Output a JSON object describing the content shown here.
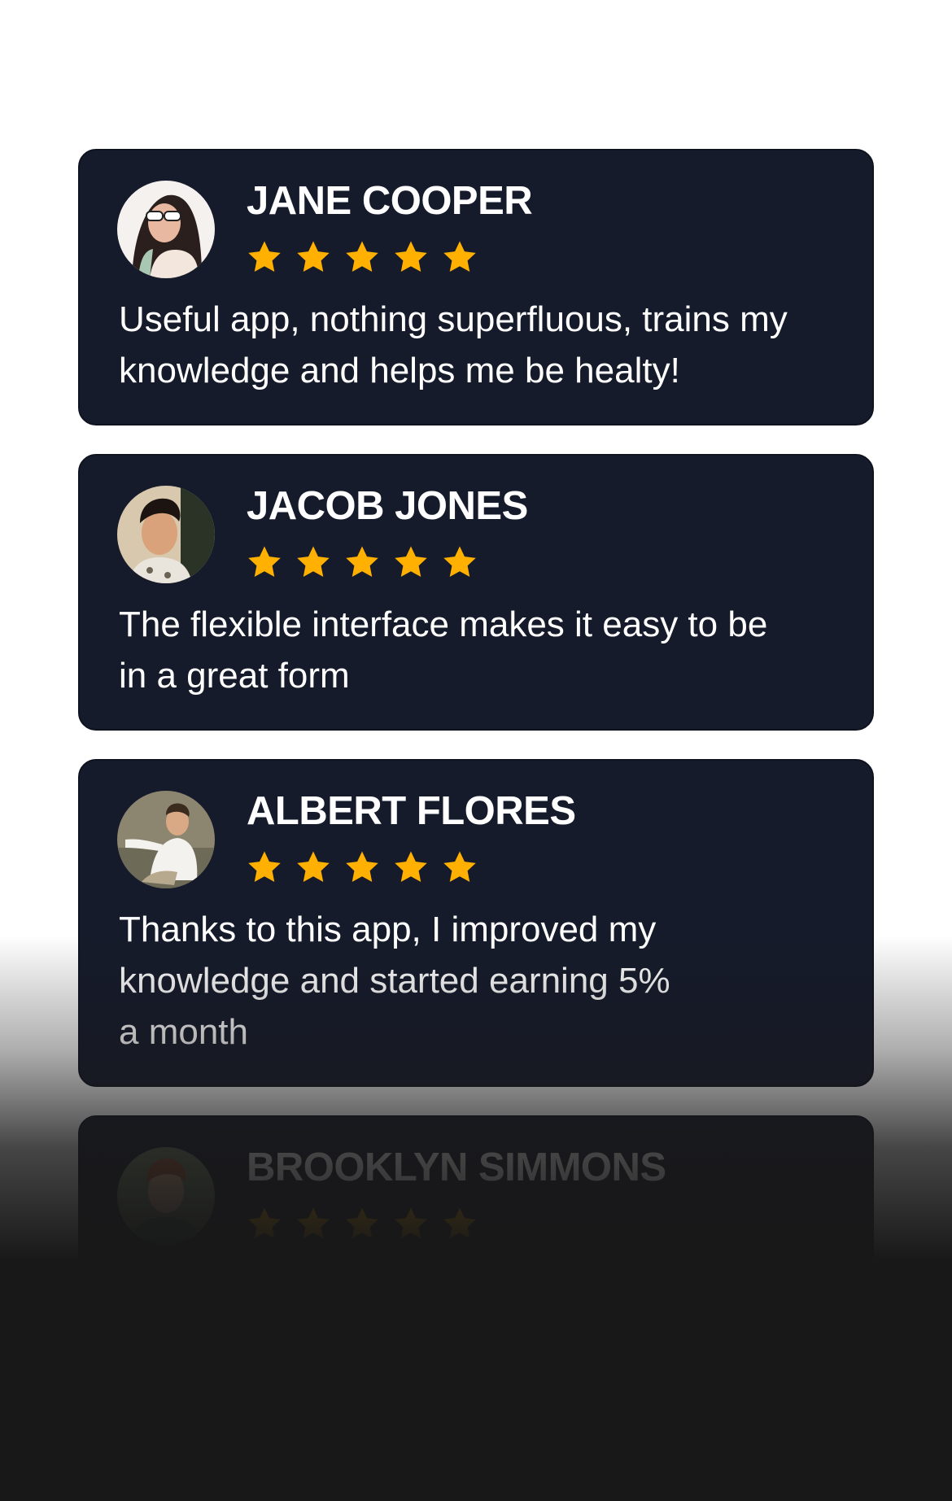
{
  "colors": {
    "card_background": "#161b2b",
    "star": "#ffb000",
    "text": "#ffffff",
    "page_background": "#ffffff",
    "bottom_overlay": "#181818"
  },
  "reviews": [
    {
      "name": "JANE COOPER",
      "rating": 5,
      "text_lines": [
        "Useful app, nothing superfluous, trains my",
        "knowledge and helps me be healty!"
      ],
      "avatar_icon": "avatar-photo-woman-sunglasses"
    },
    {
      "name": "JACOB JONES",
      "rating": 5,
      "text_lines": [
        "The flexible interface makes it easy to be",
        "in a great form"
      ],
      "avatar_icon": "avatar-photo-man-dark-hair"
    },
    {
      "name": "ALBERT FLORES",
      "rating": 5,
      "text_lines": [
        "Thanks to this app, I improved my",
        "knowledge and started earning 5%",
        "a month"
      ],
      "avatar_icon": "avatar-photo-man-white-shirt"
    },
    {
      "name": "BROOKLYN SIMMONS",
      "rating": 5,
      "text_lines": [],
      "avatar_icon": "avatar-photo-man-red-hair"
    }
  ]
}
